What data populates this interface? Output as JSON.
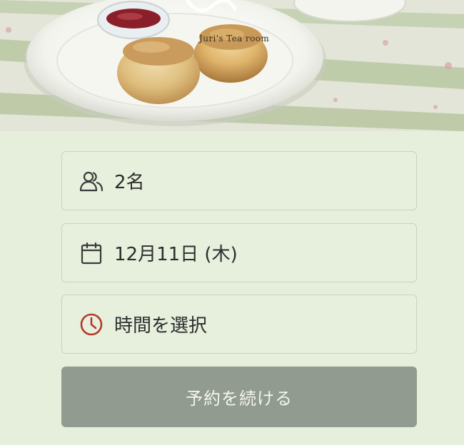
{
  "hero": {
    "brand": "Juri's Tea room",
    "image": "scones-on-plate-with-jam"
  },
  "booking": {
    "guests": {
      "label": "2名",
      "icon": "people-icon"
    },
    "date": {
      "label": "12月11日 (木)",
      "icon": "calendar-icon"
    },
    "time": {
      "label": "時間を選択",
      "icon": "clock-icon",
      "accent": "#b33a2c"
    }
  },
  "actions": {
    "continue_label": "予約を続ける"
  },
  "colors": {
    "background": "#e5efdc",
    "button": "#919b8f",
    "field_border": "#c8d2bf"
  }
}
